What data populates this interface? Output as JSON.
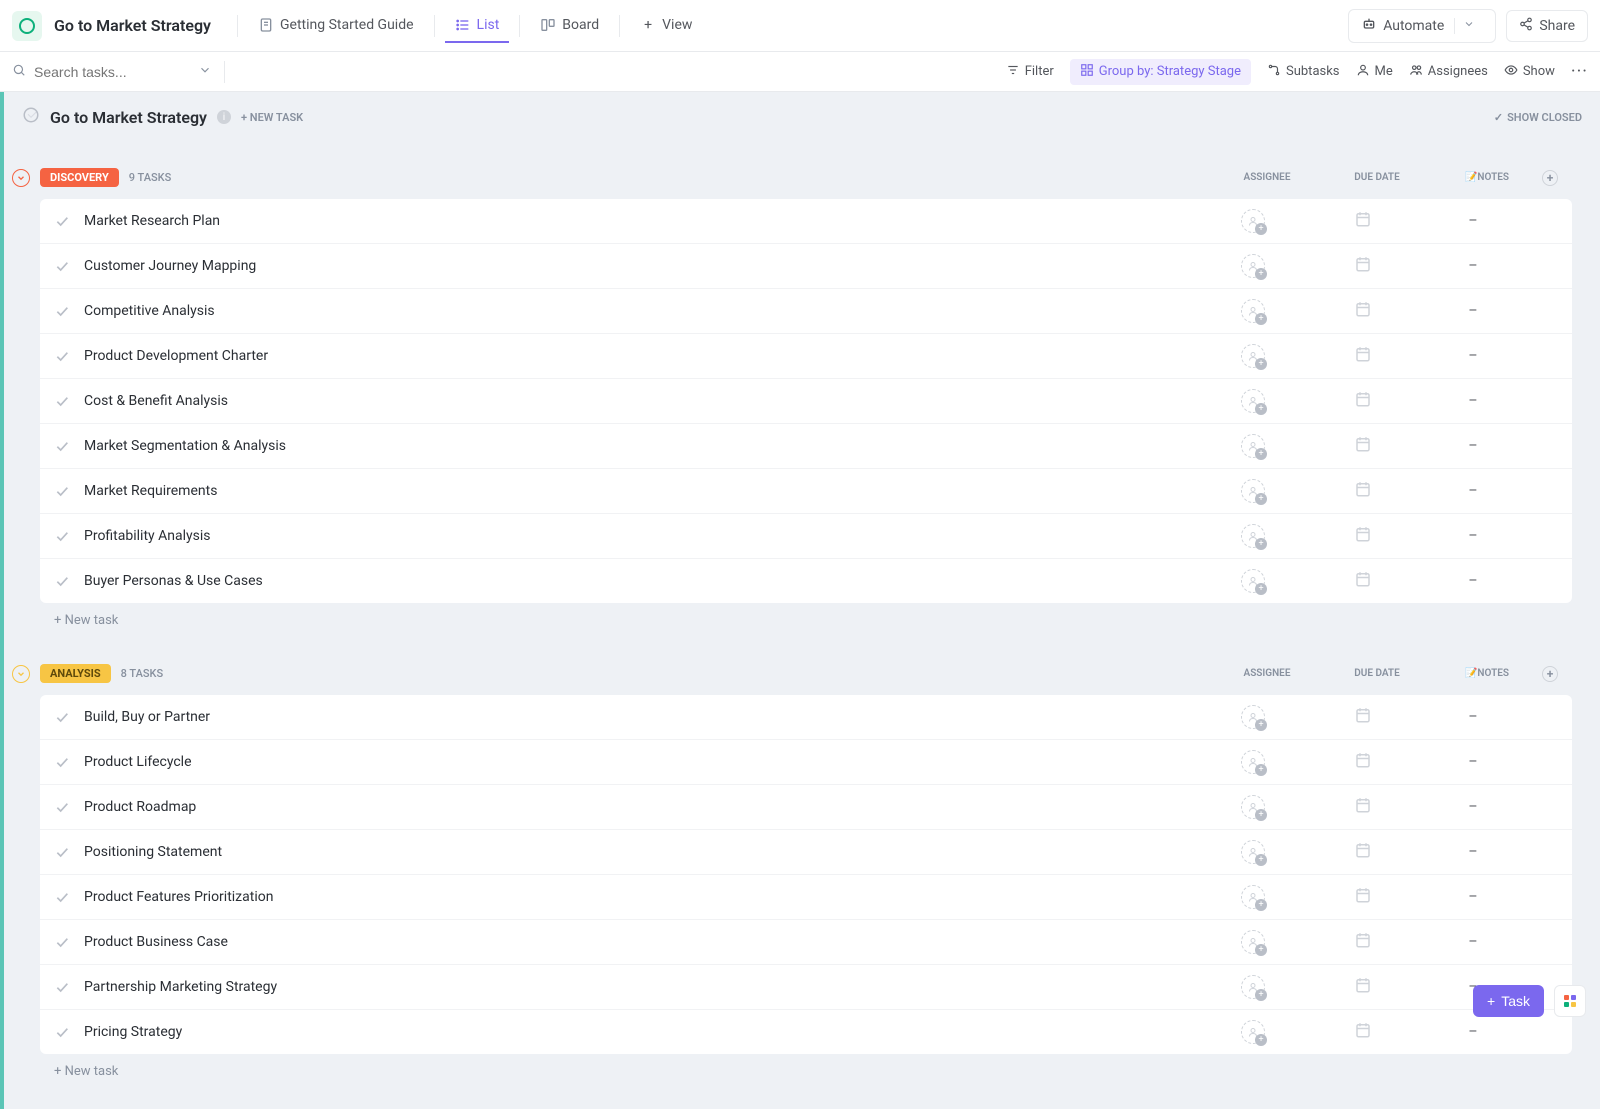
{
  "header": {
    "title": "Go to Market Strategy",
    "tabs": [
      {
        "label": "Getting Started Guide",
        "icon": "doc-icon"
      },
      {
        "label": "List",
        "icon": "list-icon",
        "active": true
      },
      {
        "label": "Board",
        "icon": "board-icon"
      },
      {
        "label": "View",
        "icon": "plus-icon"
      }
    ],
    "automate": "Automate",
    "share": "Share"
  },
  "toolbar": {
    "search_placeholder": "Search tasks...",
    "filter": "Filter",
    "group_by": "Group by: Strategy Stage",
    "subtasks": "Subtasks",
    "me": "Me",
    "assignees": "Assignees",
    "show": "Show"
  },
  "list": {
    "title": "Go to Market Strategy",
    "new_task": "+ NEW TASK",
    "show_closed": "SHOW CLOSED"
  },
  "columns": {
    "assignee": "ASSIGNEE",
    "due_date": "DUE DATE",
    "notes": "📝NOTES"
  },
  "groups": [
    {
      "stage": "DISCOVERY",
      "count": "9 TASKS",
      "color": "discovery",
      "circle": "orange",
      "tasks": [
        {
          "name": "Market Research Plan",
          "notes": "–"
        },
        {
          "name": "Customer Journey Mapping",
          "notes": "–"
        },
        {
          "name": "Competitive Analysis",
          "notes": "–"
        },
        {
          "name": "Product Development Charter",
          "notes": "–"
        },
        {
          "name": "Cost & Benefit Analysis",
          "notes": "–"
        },
        {
          "name": "Market Segmentation & Analysis",
          "notes": "–"
        },
        {
          "name": "Market Requirements",
          "notes": "–"
        },
        {
          "name": "Profitability Analysis",
          "notes": "–"
        },
        {
          "name": "Buyer Personas & Use Cases",
          "notes": "–"
        }
      ],
      "new_task": "+ New task"
    },
    {
      "stage": "ANALYSIS",
      "count": "8 TASKS",
      "color": "analysis",
      "circle": "yellow",
      "tasks": [
        {
          "name": "Build, Buy or Partner",
          "notes": "–"
        },
        {
          "name": "Product Lifecycle",
          "notes": "–"
        },
        {
          "name": "Product Roadmap",
          "notes": "–"
        },
        {
          "name": "Positioning Statement",
          "notes": "–"
        },
        {
          "name": "Product Features Prioritization",
          "notes": "–"
        },
        {
          "name": "Product Business Case",
          "notes": "–"
        },
        {
          "name": "Partnership Marketing Strategy",
          "notes": "–"
        },
        {
          "name": "Pricing Strategy",
          "notes": "–"
        }
      ],
      "new_task": "+ New task"
    }
  ],
  "fab": {
    "task": "Task"
  }
}
